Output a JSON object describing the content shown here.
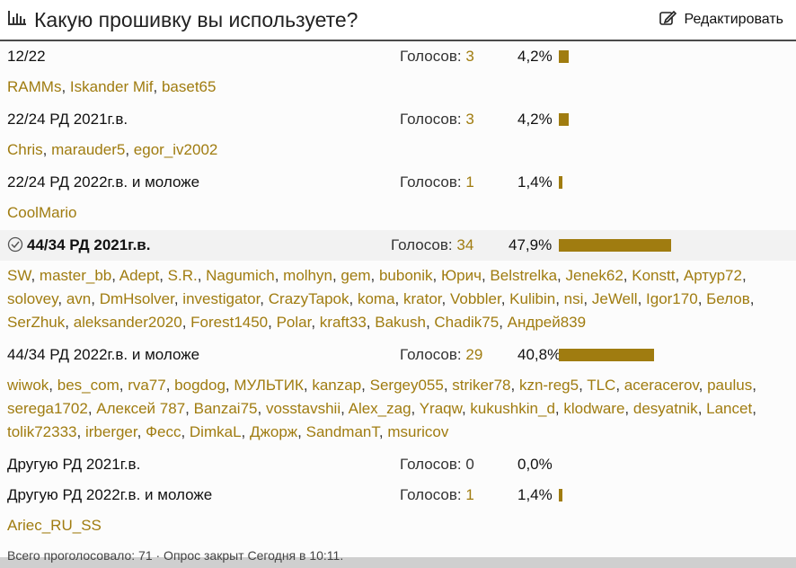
{
  "poll": {
    "title": "Какую прошивку вы используете?",
    "edit_label": "Редактировать",
    "votes_label": "Голосов:",
    "options": [
      {
        "label": "12/22",
        "votes": "3",
        "percent": "4,2%",
        "fraction": 0.042,
        "voters": [
          "RAMMs",
          "Iskander Mif",
          "baset65"
        ]
      },
      {
        "label": "22/24 РД 2021г.в.",
        "votes": "3",
        "percent": "4,2%",
        "fraction": 0.042,
        "voters": [
          "Chris",
          "marauder5",
          "egor_iv2002"
        ]
      },
      {
        "label": "22/24 РД 2022г.в. и моложе",
        "votes": "1",
        "percent": "1,4%",
        "fraction": 0.014,
        "voters": [
          "CoolMario"
        ]
      },
      {
        "label": "44/34 РД 2021г.в.",
        "votes": "34",
        "percent": "47,9%",
        "fraction": 0.479,
        "selected": true,
        "voters": [
          "SW",
          "master_bb",
          "Adept",
          "S.R.",
          "Nagumich",
          "molhyn",
          "gem",
          "bubonik",
          "Юрич",
          "Belstrelka",
          "Jenek62",
          "Konstt",
          "Артур72",
          "solovey",
          "avn",
          "DmHsolver",
          "investigator",
          "CrazyTapok",
          "koma",
          "krator",
          "Vobbler",
          "Kulibin",
          "nsi",
          "JeWell",
          "Igor170",
          "Белов",
          "SerZhuk",
          "aleksander2020",
          "Forest1450",
          "Polar",
          "kraft33",
          "Bakush",
          "Chadik75",
          "Андрей839"
        ]
      },
      {
        "label": "44/34 РД 2022г.в. и моложе",
        "votes": "29",
        "percent": "40,8%",
        "fraction": 0.408,
        "voters": [
          "wiwok",
          "bes_com",
          "rva77",
          "bogdog",
          "МУЛЬТИК",
          "kanzap",
          "Sergey055",
          "striker78",
          "kzn-reg5",
          "TLC",
          "aceracerov",
          "paulus",
          "serega1702",
          "Алексей 787",
          "Banzai75",
          "vosstavshii",
          "Alex_zag",
          "Yraqw",
          "kukushkin_d",
          "klodware",
          "desyatnik",
          "Lancet",
          "tolik72333",
          "irberger",
          "Фесс",
          "DimkaL",
          "Джорж",
          "SandmanT",
          "msuricov"
        ]
      },
      {
        "label": "Другую РД 2021г.в.",
        "votes": "0",
        "percent": "0,0%",
        "fraction": 0.0,
        "voters": []
      },
      {
        "label": "Другую РД 2022г.в. и моложе",
        "votes": "1",
        "percent": "1,4%",
        "fraction": 0.014,
        "voters": [
          "Ariec_RU_SS"
        ]
      }
    ],
    "footer": "Всего проголосовало: 71 · Опрос закрыт Сегодня в 10:11."
  },
  "colors": {
    "accent": "#a07c10",
    "text": "#111111"
  },
  "icons": {
    "title": "bar-chart-icon",
    "edit": "edit-icon",
    "selected": "check-circle-icon"
  }
}
